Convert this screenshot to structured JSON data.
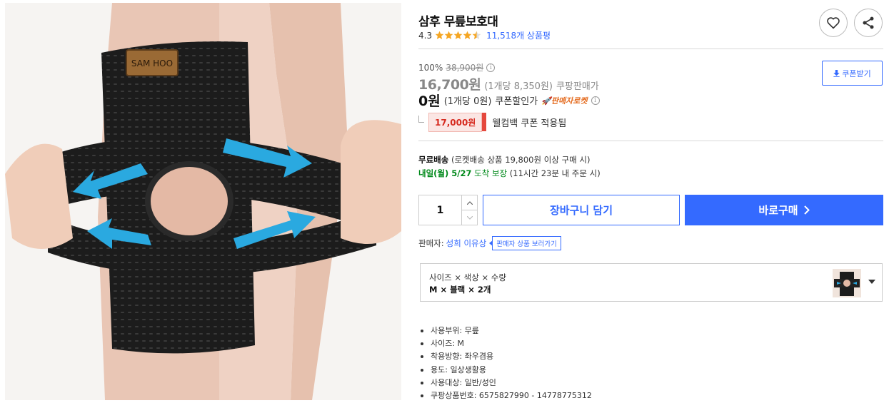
{
  "product": {
    "title": "삼후 무릎보호대",
    "rating": "4.3",
    "stars": 4.5,
    "review_count": "11,518개 상품평",
    "brand_patch": "SAM HOO"
  },
  "pricing": {
    "discount_rate": "100%",
    "original_price": "38,900원",
    "sale_price": "16,700원",
    "sale_unit": "(1개당 8,350원)",
    "sale_label": "쿠팡판매가",
    "coupon_price": "0원",
    "coupon_unit": "(1개당 0원)",
    "coupon_label": "쿠폰할인가",
    "rocket_label": "🚀판매자로켓",
    "coupon_button": "쿠폰받기",
    "welcome_amount": "17,000원",
    "welcome_text": "웰컴백 쿠폰 적용됨"
  },
  "shipping": {
    "free_label": "무료배송",
    "free_detail": "(로켓배송 상품 19,800원 이상 구매 시)",
    "date": "내일(월) 5/27",
    "guarantee": "도착 보장",
    "cutoff": "(11시간 23분 내 주문 시)"
  },
  "purchase": {
    "quantity": "1",
    "cart_label": "장바구니 담기",
    "buy_label": "바로구매",
    "buy_arrow": "›"
  },
  "seller": {
    "prefix": "판매자:",
    "name": "성희 이유상",
    "tooltip": "판매자 상품 보러가기"
  },
  "option": {
    "label": "사이즈 × 색상 × 수량",
    "value": "M × 블랙 × 2개"
  },
  "specs": [
    "사용부위: 무릎",
    "사이즈: M",
    "착용방향: 좌우겸용",
    "용도: 일상생활용",
    "사용대상: 일반/성인",
    "쿠팡상품번호: 6575827990 - 14778775312"
  ],
  "colors": {
    "accent": "#346aff",
    "delivery_green": "#00891a",
    "coupon_red": "#d62a1f",
    "star": "#f5a623"
  },
  "icons": [
    "heart-icon",
    "share-icon",
    "info-icon",
    "download-icon",
    "chevron-right-icon",
    "caret-down-icon"
  ]
}
